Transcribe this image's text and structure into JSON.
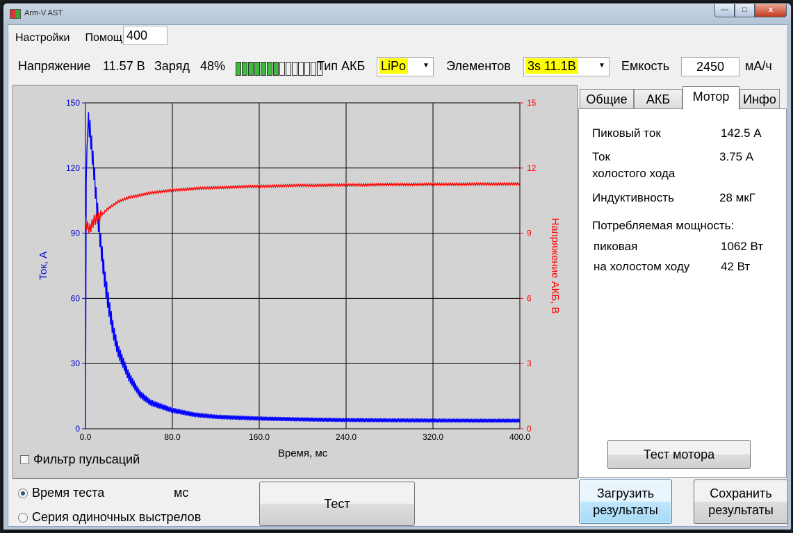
{
  "window": {
    "title": "Arm-V AST",
    "buttons": {
      "minimize": "—",
      "maximize": "□",
      "close": "x"
    }
  },
  "menu": [
    "Настройки",
    "Помощь"
  ],
  "toolbar": {
    "voltage_label": "Напряжение",
    "voltage_value": "11.57 В",
    "charge_label": "Заряд",
    "charge_value": "48%",
    "charge_level": 0.5,
    "battery_type_label": "Тип АКБ",
    "battery_type_value": "LiPo",
    "cells_label": "Элементов",
    "cells_value": "3s 11.1B",
    "capacity_label": "Емкость",
    "capacity_value": "2450",
    "capacity_unit": "мА/ч"
  },
  "tabs": [
    {
      "label": "Общие",
      "active": false
    },
    {
      "label": "АКБ",
      "active": false
    },
    {
      "label": "Мотор",
      "active": true
    },
    {
      "label": "Инфо",
      "active": false
    }
  ],
  "motor": {
    "peak_current_label": "Пиковый ток",
    "peak_current_value": "142.5 А",
    "idle_current_label_1": "Ток",
    "idle_current_label_2": "холостого хода",
    "idle_current_value": "3.75 А",
    "inductance_label": "Индуктивность",
    "inductance_value": "28 мкГ",
    "power_label": "Потребляемая мощность:",
    "power_peak_label": "пиковая",
    "power_peak_value": "1062 Вт",
    "power_idle_label": "на холостом ходу",
    "power_idle_value": "42 Вт",
    "test_button": "Тест мотора"
  },
  "filter_label": "Фильтр пульсаций",
  "bottom": {
    "test_time_label": "Время теста",
    "test_time_value": "400",
    "test_time_unit": "мс",
    "series_label": "Серия одиночных выстрелов",
    "test_button": "Тест",
    "load_button_1": "Загрузить",
    "load_button_2": "результаты",
    "save_button_1": "Сохранить",
    "save_button_2": "результаты"
  },
  "chart_data": {
    "type": "line",
    "xlabel": "Время, мс",
    "ylabel_left": "Ток, А",
    "ylabel_right": "Напряжение АКБ, В",
    "xlim": [
      0,
      400
    ],
    "ylim_left": [
      0,
      150
    ],
    "ylim_right": [
      0,
      15
    ],
    "x_ticks": [
      "0.0",
      "80.0",
      "160.0",
      "240.0",
      "320.0",
      "400.0"
    ],
    "y_left_ticks": [
      "0",
      "30",
      "60",
      "90",
      "120",
      "150"
    ],
    "y_right_ticks": [
      "0",
      "3",
      "6",
      "9",
      "12",
      "15"
    ],
    "grid": true,
    "series": [
      {
        "axis": "left",
        "color": "#0000ff",
        "x": [
          0,
          0.5,
          2,
          4,
          6,
          8,
          10,
          14,
          18,
          22,
          26,
          30,
          40,
          50,
          60,
          80,
          100,
          120,
          160,
          200,
          240,
          280,
          320,
          360,
          400
        ],
        "y": [
          0,
          110,
          142.5,
          138,
          128,
          118,
          105,
          85,
          68,
          55,
          44,
          36,
          24,
          16,
          12,
          8.5,
          6.5,
          5.5,
          4.7,
          4.3,
          4.0,
          3.9,
          3.8,
          3.75,
          3.75
        ]
      },
      {
        "axis": "right",
        "color": "#ff0000",
        "x": [
          0,
          2,
          4,
          6,
          8,
          12,
          16,
          20,
          30,
          40,
          60,
          80,
          100,
          120,
          160,
          200,
          240,
          280,
          320,
          360,
          400
        ],
        "y": [
          9.5,
          9.3,
          9.2,
          9.4,
          9.6,
          9.7,
          9.9,
          10.1,
          10.45,
          10.65,
          10.85,
          10.98,
          11.05,
          11.1,
          11.16,
          11.2,
          11.22,
          11.24,
          11.25,
          11.26,
          11.27
        ]
      }
    ]
  }
}
